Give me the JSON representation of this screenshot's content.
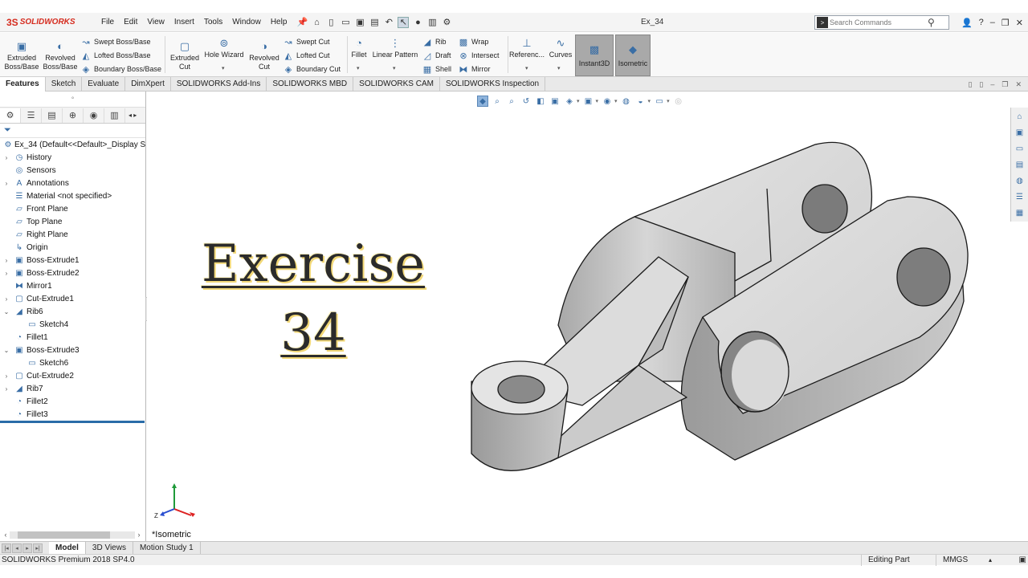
{
  "app": {
    "logo_mark": "3S",
    "logo_text": "SOLIDWORKS",
    "document_title": "Ex_34",
    "menu": [
      "File",
      "Edit",
      "View",
      "Insert",
      "Tools",
      "Window",
      "Help"
    ],
    "search_placeholder": "Search Commands"
  },
  "command_manager": {
    "extruded_boss": "Extruded Boss/Base",
    "revolved_boss": "Revolved Boss/Base",
    "swept_boss": "Swept Boss/Base",
    "lofted_boss": "Lofted Boss/Base",
    "boundary_boss": "Boundary Boss/Base",
    "extruded_cut": "Extruded Cut",
    "hole_wizard": "Hole Wizard",
    "revolved_cut": "Revolved Cut",
    "swept_cut": "Swept Cut",
    "lofted_cut": "Lofted Cut",
    "boundary_cut": "Boundary Cut",
    "fillet": "Fillet",
    "linear_pattern": "Linear Pattern",
    "rib": "Rib",
    "draft": "Draft",
    "shell": "Shell",
    "wrap": "Wrap",
    "intersect": "Intersect",
    "mirror": "Mirror",
    "reference": "Referenc...",
    "curves": "Curves",
    "instant3d": "Instant3D",
    "isometric": "Isometric"
  },
  "tabs": [
    "Features",
    "Sketch",
    "Evaluate",
    "DimXpert",
    "SOLIDWORKS Add-Ins",
    "SOLIDWORKS MBD",
    "SOLIDWORKS CAM",
    "SOLIDWORKS Inspection"
  ],
  "feature_tree": [
    {
      "label": "Ex_34  (Default<<Default>_Display S",
      "icon": "part-icon"
    },
    {
      "label": "History",
      "icon": "history-icon"
    },
    {
      "label": "Sensors",
      "icon": "sensor-icon"
    },
    {
      "label": "Annotations",
      "icon": "annotation-icon"
    },
    {
      "label": "Material <not specified>",
      "icon": "material-icon"
    },
    {
      "label": "Front Plane",
      "icon": "plane-icon"
    },
    {
      "label": "Top Plane",
      "icon": "plane-icon"
    },
    {
      "label": "Right Plane",
      "icon": "plane-icon"
    },
    {
      "label": "Origin",
      "icon": "origin-icon"
    },
    {
      "label": "Boss-Extrude1",
      "icon": "extrude-icon"
    },
    {
      "label": "Boss-Extrude2",
      "icon": "extrude-icon"
    },
    {
      "label": "Mirror1",
      "icon": "mirror-icon"
    },
    {
      "label": "Cut-Extrude1",
      "icon": "cut-icon"
    },
    {
      "label": "Rib6",
      "icon": "rib-icon"
    },
    {
      "label": "Sketch4",
      "icon": "sketch-icon"
    },
    {
      "label": "Fillet1",
      "icon": "fillet-icon"
    },
    {
      "label": "Boss-Extrude3",
      "icon": "extrude-icon"
    },
    {
      "label": "Sketch6",
      "icon": "sketch-icon"
    },
    {
      "label": "Cut-Extrude2",
      "icon": "cut-icon"
    },
    {
      "label": "Rib7",
      "icon": "rib-icon"
    },
    {
      "label": "Fillet2",
      "icon": "fillet-icon"
    },
    {
      "label": "Fillet3",
      "icon": "fillet-icon"
    }
  ],
  "viewport": {
    "title_line1": "Exercise",
    "title_line2": "34",
    "view_name": "*Isometric",
    "triad_z": "Z"
  },
  "bottom_tabs": [
    "Model",
    "3D Views",
    "Motion Study 1"
  ],
  "status": {
    "product": "SOLIDWORKS Premium 2018 SP4.0",
    "mode": "Editing Part",
    "units": "MMGS"
  },
  "colors": {
    "brand": "#d52b1e",
    "accent": "#2a6ca8",
    "toggle_active": "#a9a9a9"
  }
}
